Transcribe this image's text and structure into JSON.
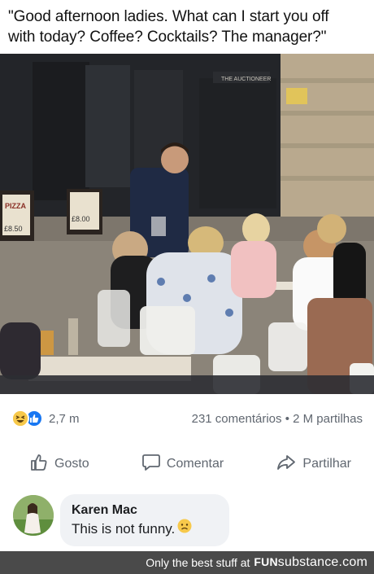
{
  "caption": {
    "line1": "\"Good afternoon ladies. What can I start you off",
    "line2": "with today? Coffee? Cocktails? The manager?\""
  },
  "photo": {
    "signs": {
      "sign_left_top": "PIZZA",
      "sign_left_price": "£8.50",
      "sign_mid_price": "£8.00",
      "storefront": "THE AUCTIONEER"
    }
  },
  "reactions": {
    "icons": [
      "haha-icon",
      "like-icon"
    ],
    "count": "2,7 m",
    "comments": "231 comentários",
    "separator": "•",
    "shares": "2 M partilhas"
  },
  "actions": {
    "like_label": "Gosto",
    "comment_label": "Comentar",
    "share_label": "Partilhar"
  },
  "comment": {
    "author": "Karen Mac",
    "text": "This is not funny.",
    "emoji": "frowning-face"
  },
  "footer": {
    "prefix": "Only the best stuff at",
    "brand_bold": "FUN",
    "brand_light": "substance",
    "brand_suffix": ".com"
  },
  "colors": {
    "like_blue": "#1877f2",
    "haha_yellow": "#f7c94b",
    "comment_bubble": "#f0f2f5",
    "footer_bg": "#4a4a4a",
    "meta_text": "#606770"
  }
}
